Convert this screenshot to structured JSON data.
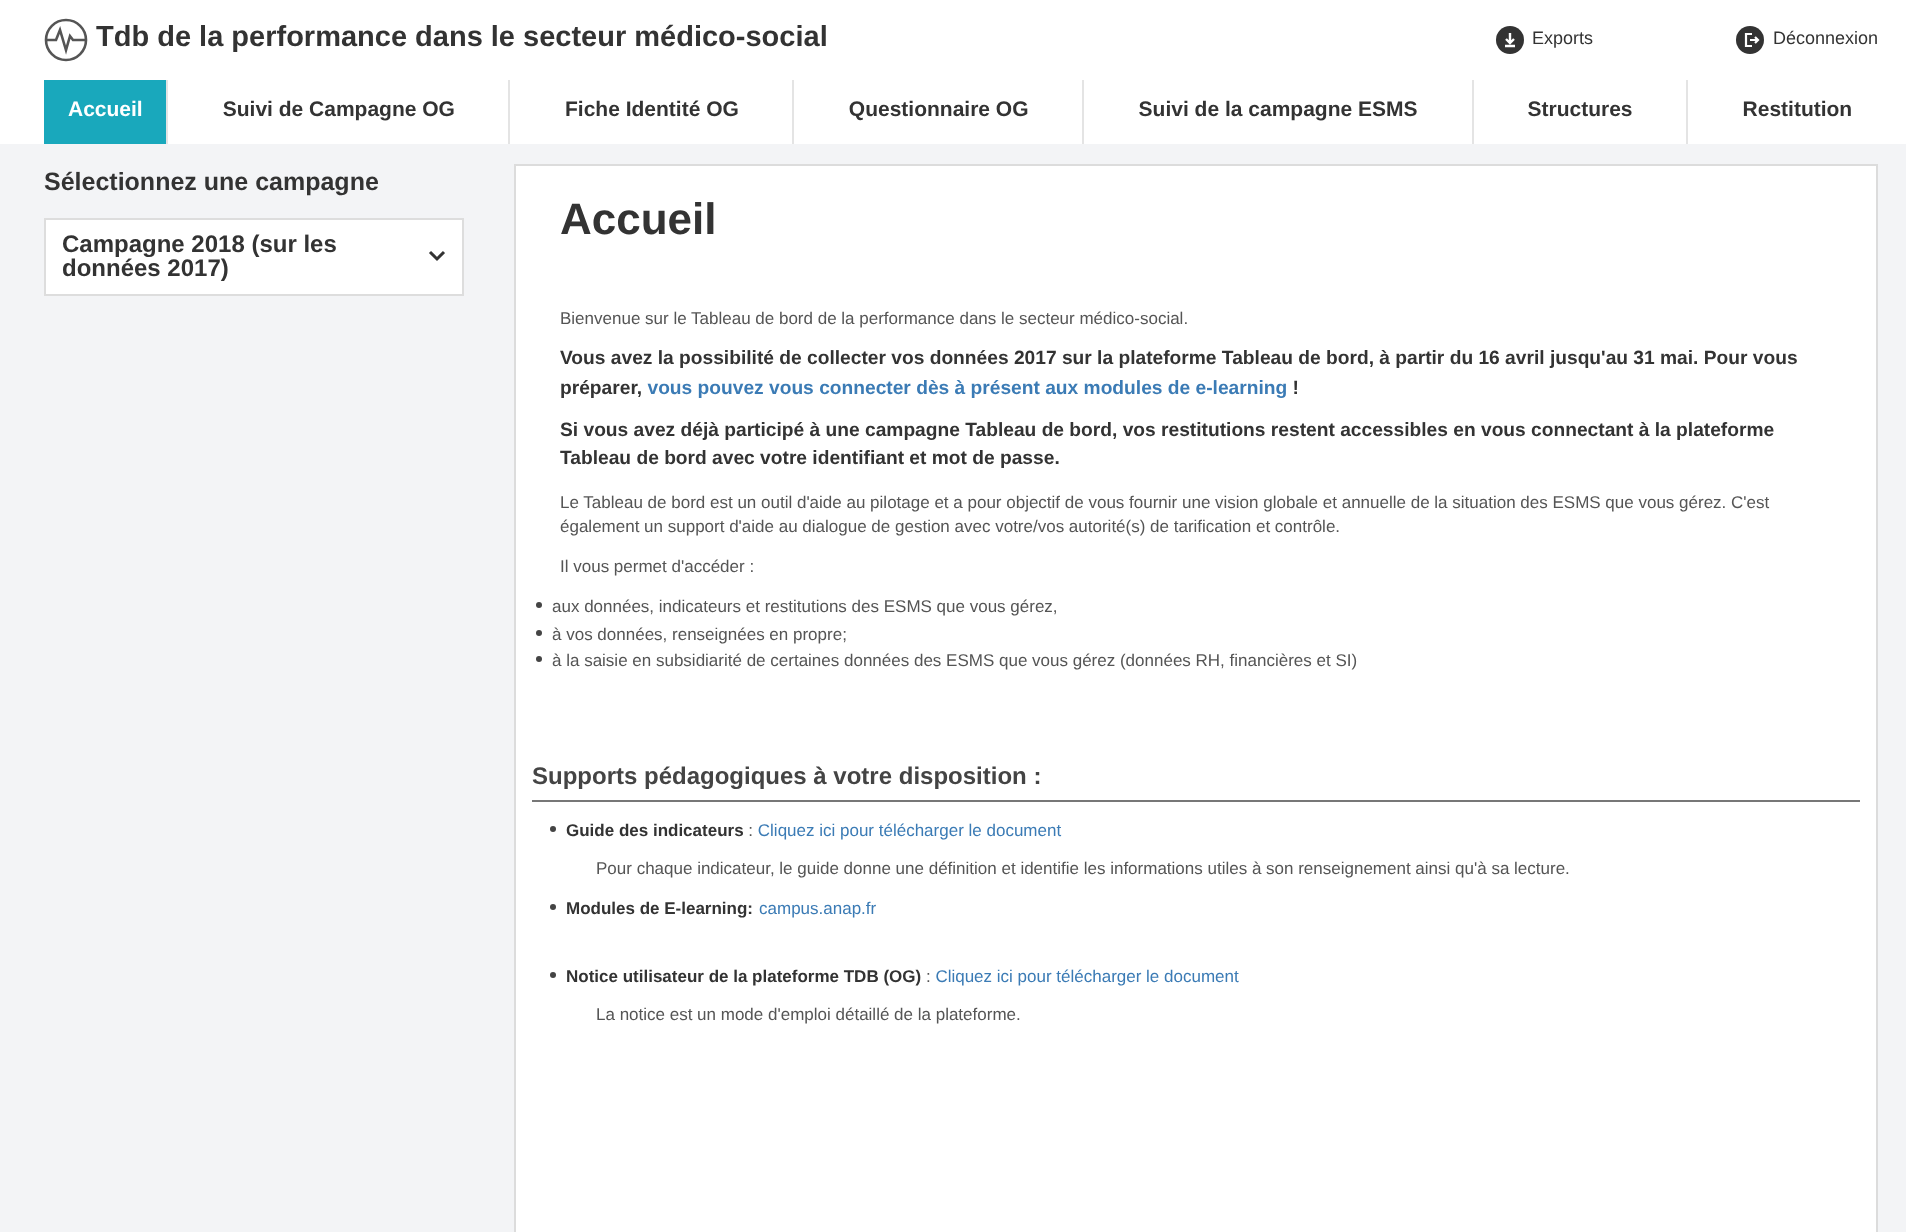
{
  "header": {
    "title": "Tdb de la performance dans le secteur médico-social",
    "actions": [
      {
        "label": "Exports",
        "kind": "export"
      },
      {
        "label": "Déconnexion",
        "kind": "logout"
      }
    ]
  },
  "tabs": [
    {
      "label": "Accueil",
      "selected": true
    },
    {
      "label": "Suivi de Campagne OG",
      "selected": false
    },
    {
      "label": "Fiche Identité OG",
      "selected": false
    },
    {
      "label": "Questionnaire OG",
      "selected": false
    },
    {
      "label": "Suivi de la campagne ESMS",
      "selected": false
    },
    {
      "label": "Structures",
      "selected": false
    },
    {
      "label": "Restitution",
      "selected": false
    }
  ],
  "sidebar": {
    "label": "Sélectionnez une campagne",
    "select": {
      "value": "Campagne 2018 (sur les données 2017)"
    }
  },
  "main": {
    "title": "Accueil",
    "paragraphs": [
      {
        "bold": false,
        "parts": [
          {
            "kind": "text",
            "text": "Bienvenue sur le Tableau de bord de la performance dans le secteur médico-social."
          }
        ]
      },
      {
        "bold": true,
        "parts": [
          {
            "kind": "text",
            "text": "Vous avez la possibilité de collecter vos données 2017 sur la plateforme Tableau de bord, à partir du 16 avril jusqu'au 31 mai. Pour vous préparer, "
          },
          {
            "kind": "link",
            "text": "vous pouvez vous connecter dès à présent aux modules de e-learning"
          },
          {
            "kind": "text",
            "text": " !"
          }
        ]
      },
      {
        "bold": true,
        "parts": [
          {
            "kind": "text",
            "text": "Si vous avez déjà participé à une campagne Tableau de bord, vos restitutions restent accessibles en vous connectant à la plateforme Tableau de bord avec votre identifiant et mot de passe."
          }
        ]
      },
      {
        "bold": false,
        "parts": [
          {
            "kind": "text",
            "text": "Le Tableau de bord est un outil d'aide au pilotage et a pour objectif de vous fournir une vision globale et annuelle de la situation des ESMS que vous gérez. C'est également un support d'aide au dialogue de gestion avec votre/vos autorité(s) de tarification et contrôle."
          }
        ]
      },
      {
        "bold": false,
        "parts": [
          {
            "kind": "text",
            "text": "Il vous permet d'accéder :"
          }
        ]
      }
    ],
    "bullets": [
      "aux données, indicateurs et restitutions des ESMS que vous gérez,",
      "à vos données, renseignées en propre;",
      "à la saisie en subsidiarité de certaines données des ESMS que vous gérez (données RH, financières et SI)"
    ],
    "section_title": "Supports pédagogiques à votre disposition :",
    "resources": [
      {
        "label": "Guide des indicateurs",
        "separator": " : ",
        "link": "Cliquez ici pour télécharger le document",
        "description": "Pour chaque indicateur, le guide donne une définition et identifie les informations utiles à son renseignement ainsi qu'à sa lecture."
      },
      {
        "label": "Modules de E-learning:",
        "link": "campus.anap.fr"
      },
      {
        "label": "Notice utilisateur de la plateforme TDB (OG)",
        "separator": " : ",
        "link": "Cliquez ici pour télécharger le document",
        "description": "La notice est un mode d'emploi détaillé de la plateforme."
      }
    ]
  }
}
